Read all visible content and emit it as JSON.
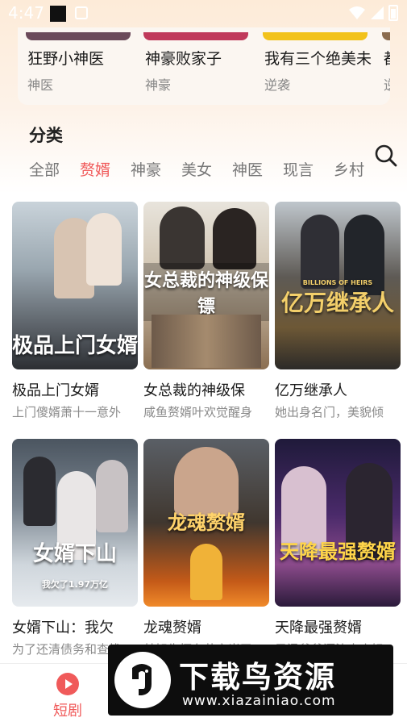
{
  "status_bar": {
    "time": "4:47"
  },
  "top_row": [
    {
      "title": "狂野小神医",
      "tag": "神医",
      "strip_color": "#6b4a5a"
    },
    {
      "title": "神豪败家子",
      "tag": "神豪",
      "strip_color": "#c0395a"
    },
    {
      "title": "我有三个绝美未",
      "tag": "逆袭",
      "strip_color": "#f2c21b"
    },
    {
      "title": "都",
      "tag": "逆",
      "strip_color": "#8a6b4e"
    }
  ],
  "category": {
    "title": "分类",
    "tabs": [
      "全部",
      "赘婿",
      "神豪",
      "美女",
      "神医",
      "现言",
      "乡村"
    ],
    "active_index": 1
  },
  "dramas": [
    {
      "title": "极品上门女婿",
      "desc": "上门傻婿萧十一意外",
      "poster_text": "极品上门女婿"
    },
    {
      "title": "女总裁的神级保",
      "desc": "咸鱼赘婿叶欢觉醒身",
      "poster_text": "女总裁的神级保镖"
    },
    {
      "title": "亿万继承人",
      "desc": "她出身名门，美貌倾",
      "poster_text": "亿万继承人"
    },
    {
      "title": "女婿下山：我欠",
      "desc": "为了还清债务和查找",
      "poster_text": "女婿下山"
    },
    {
      "title": "龙魂赘婿",
      "desc": "林旭生怀在苏家当了",
      "poster_text": "龙魂赘婿"
    },
    {
      "title": "天降最强赘婿",
      "desc": "子涵爷爷漂泊大小姐",
      "poster_text": "天降最强赘婿"
    }
  ],
  "poster_overlays": {
    "p2_sub": "BILLIONS OF HEIRS",
    "p3_sub": "我欠了1.97万亿"
  },
  "bottom_nav": {
    "active_label": "短剧"
  },
  "watermark": {
    "main": "下载鸟资源",
    "sub": "www.xiazainiao.com"
  },
  "colors": {
    "accent": "#f05a5a",
    "active_tab": "#f05a5a",
    "muted_text": "#8a8a8a"
  },
  "icons": [
    "search-icon",
    "play-circle-icon",
    "wifi-icon",
    "signal-icon",
    "battery-icon"
  ]
}
